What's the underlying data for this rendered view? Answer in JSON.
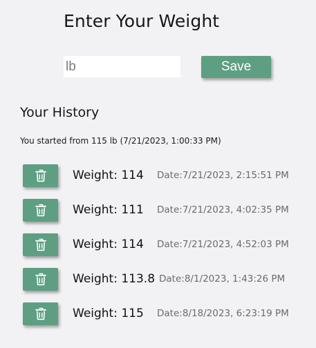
{
  "header": {
    "title": "Enter Your Weight"
  },
  "form": {
    "input_placeholder": "lb",
    "input_value": "",
    "save_label": "Save"
  },
  "history": {
    "title": "Your History",
    "started_text": "You started from 115 lb (7/21/2023, 1:00:33 PM)",
    "entries": [
      {
        "weight": "Weight: 114",
        "date": "Date:7/21/2023, 2:15:51 PM"
      },
      {
        "weight": "Weight: 111",
        "date": "Date:7/21/2023, 4:02:35 PM"
      },
      {
        "weight": "Weight: 114",
        "date": "Date:7/21/2023, 4:52:03 PM"
      },
      {
        "weight": "Weight: 113.8",
        "date": "Date:8/1/2023, 1:43:26 PM"
      },
      {
        "weight": "Weight: 115",
        "date": "Date:8/18/2023, 6:23:19 PM"
      }
    ]
  },
  "icons": {
    "delete": "trash-icon"
  },
  "colors": {
    "accent": "#5e9e83",
    "background": "#f2f2f4",
    "date_text": "#6b6b6b"
  }
}
